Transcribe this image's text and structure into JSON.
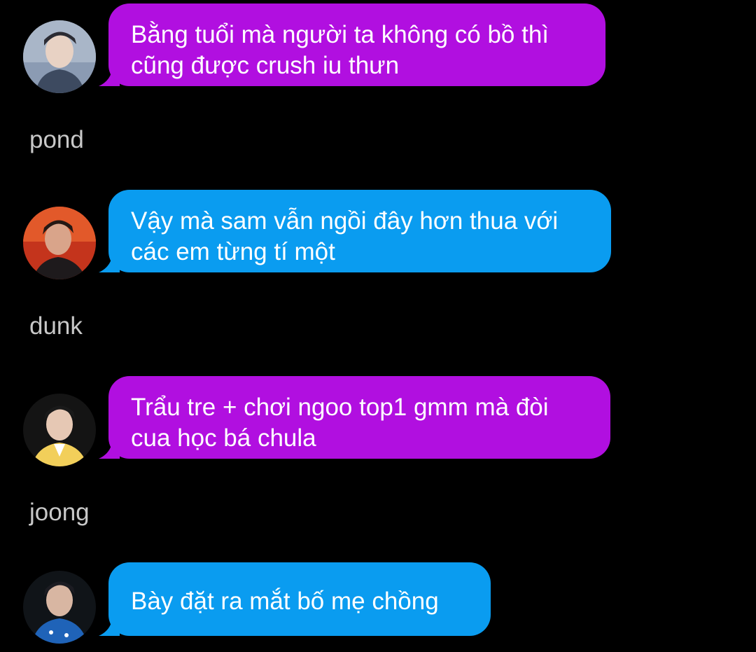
{
  "colors": {
    "background": "#000000",
    "purple_bubble": "#b10fe0",
    "blue_bubble": "#0a9cf0",
    "text": "#ffffff",
    "name": "#c8c8c8"
  },
  "messages": [
    {
      "lines": [
        "Bằng tuổi mà người ta không có bồ thì",
        "cũng được crush iu thưn"
      ],
      "color": "purple",
      "avatar_icon": "profile-photo-icon"
    },
    {
      "lines": [
        "Vậy mà sam vẫn ngồi đây hơn thua với",
        "các em từng tí một"
      ],
      "color": "blue",
      "avatar_icon": "profile-photo-icon"
    },
    {
      "lines": [
        "Trẩu tre + chơi ngoo top1 gmm mà đòi",
        "cua học bá chula"
      ],
      "color": "purple",
      "avatar_icon": "profile-photo-icon"
    },
    {
      "lines": [
        "Bày đặt ra mắt bố mẹ chồng"
      ],
      "color": "blue",
      "avatar_icon": "profile-photo-icon"
    }
  ],
  "names": [
    "pond",
    "dunk",
    "joong"
  ]
}
